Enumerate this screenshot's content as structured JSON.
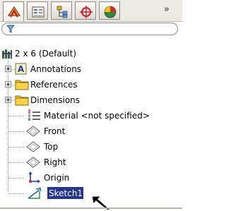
{
  "toolbar": {
    "tabs": [
      {
        "icon": "feature-manager-icon",
        "active": true
      },
      {
        "icon": "property-manager-icon",
        "active": false
      },
      {
        "icon": "configuration-manager-icon",
        "active": false
      },
      {
        "icon": "dimxpert-manager-icon",
        "active": false
      },
      {
        "icon": "display-manager-icon",
        "active": false
      }
    ],
    "more_label": "»"
  },
  "filter": {
    "icon": "funnel-filter-icon"
  },
  "tree": {
    "root": {
      "label": "2 x 6  (Default)",
      "icon": "part-icon"
    },
    "items": [
      {
        "label": "Annotations",
        "icon": "annotations-icon",
        "expandable": true
      },
      {
        "label": "References",
        "icon": "folder-icon",
        "expandable": true
      },
      {
        "label": "Dimensions",
        "icon": "folder-icon",
        "expandable": true
      },
      {
        "label": "Material <not specified>",
        "icon": "material-icon",
        "expandable": false
      },
      {
        "label": "Front",
        "icon": "plane-icon",
        "expandable": false
      },
      {
        "label": "Top",
        "icon": "plane-icon",
        "expandable": false
      },
      {
        "label": "Right",
        "icon": "plane-icon",
        "expandable": false
      },
      {
        "label": "Origin",
        "icon": "origin-icon",
        "expandable": false
      },
      {
        "label": "Sketch1",
        "icon": "sketch-icon",
        "expandable": false,
        "selected": true
      }
    ]
  },
  "colors": {
    "selection": "#27358c",
    "selection_text": "#ffffff",
    "panel": "#eceae4",
    "accent_red": "#cc1f2d"
  }
}
